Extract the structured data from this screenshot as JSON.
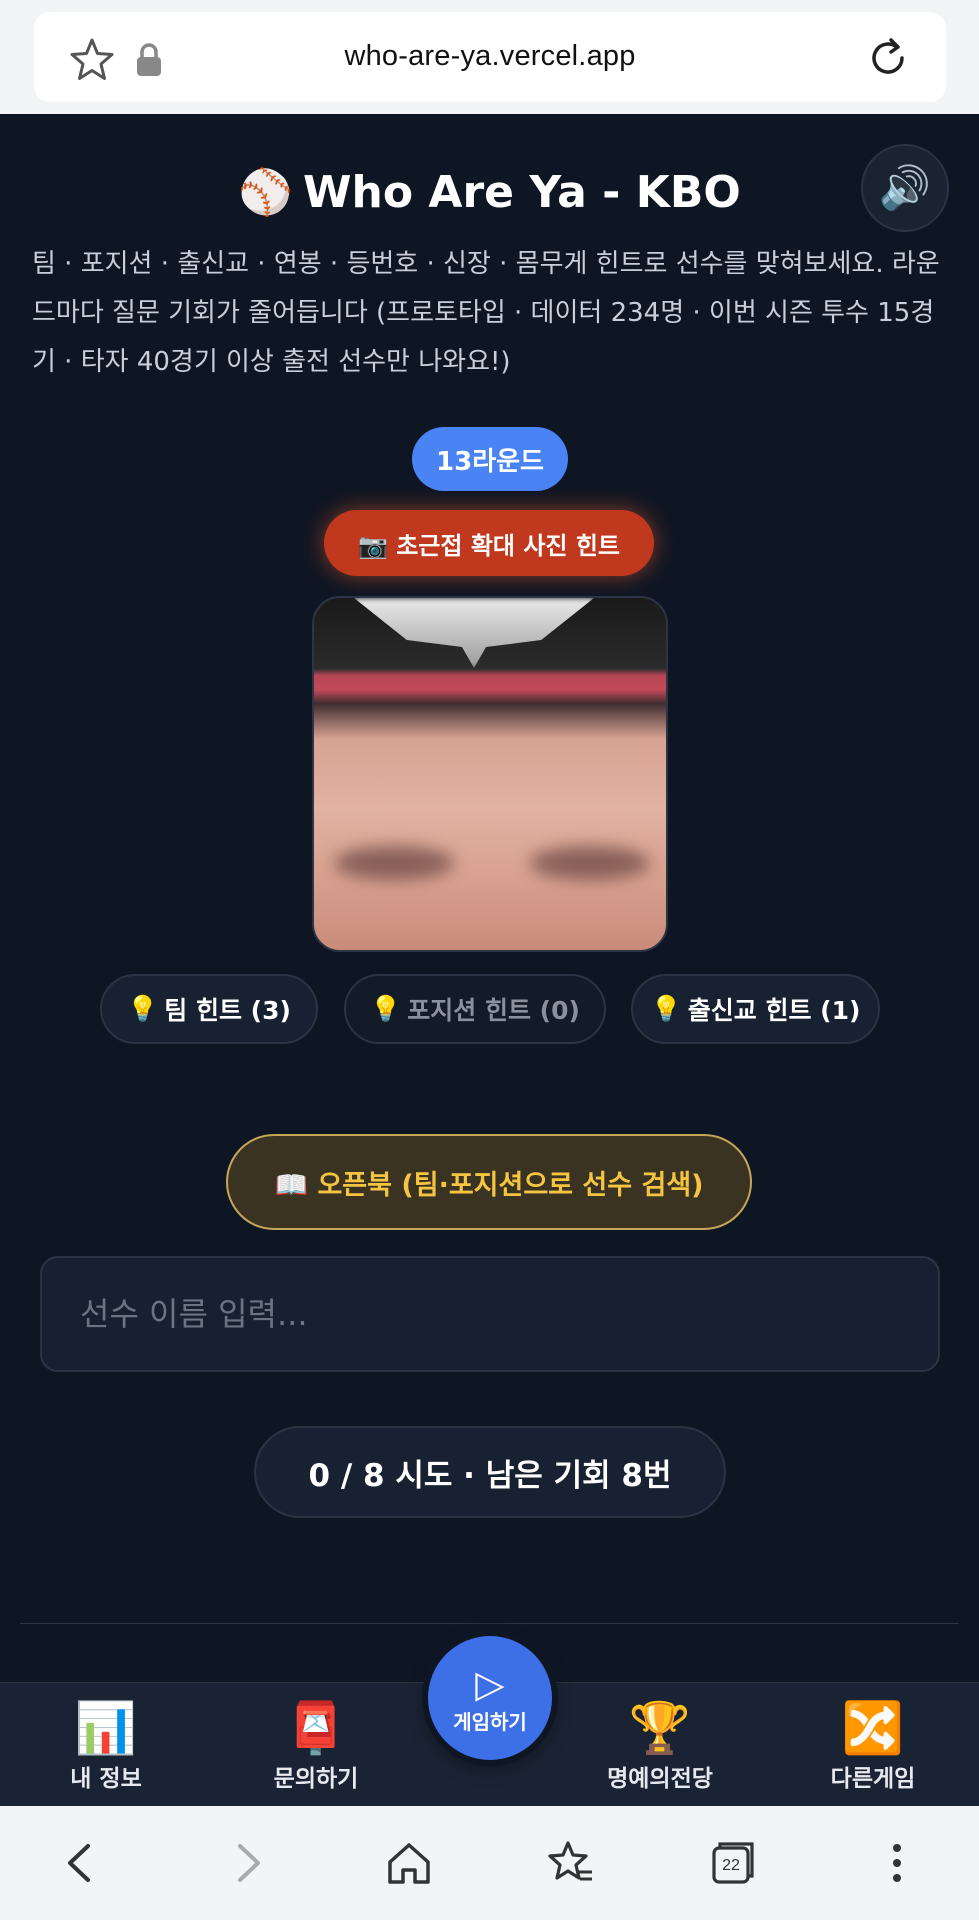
{
  "browser": {
    "url": "who-are-ya.vercel.app",
    "tab_count": "22"
  },
  "app": {
    "title_icon": "⚾",
    "title": "Who Are Ya - KBO",
    "sound_icon": "🔊",
    "subtitle": "팀 · 포지션 · 출신교 · 연봉 · 등번호 · 신장 · 몸무게 힌트로 선수를 맞혀보세요. 라운드마다 질문 기회가 줄어듭니다 (프로토타입 · 데이터 234명 · 이번 시즌 투수 15경기 · 타자 40경기 이상 출전 선수만 나와요!)",
    "round_label": "13라운드",
    "photo_hint_label": "📷 초근접 확대 사진 힌트",
    "hints": [
      {
        "icon": "💡",
        "label": "팀 힌트 (3)",
        "enabled": true
      },
      {
        "icon": "💡",
        "label": "포지션 힌트 (0)",
        "enabled": false
      },
      {
        "icon": "💡",
        "label": "출신교 힌트 (1)",
        "enabled": true
      }
    ],
    "openbook_label": "📖 오픈북 (팀·포지션으로 선수 검색)",
    "search": {
      "placeholder": "선수 이름 입력...",
      "value": ""
    },
    "attempts_text": "0 / 8 시도 · 남은 기회 8번"
  },
  "nav": {
    "items": [
      {
        "icon": "📊",
        "label": "내 정보"
      },
      {
        "icon": "📮",
        "label": "문의하기"
      },
      {
        "icon": "🏆",
        "label": "명예의전당"
      },
      {
        "icon": "🔀",
        "label": "다른게임"
      }
    ],
    "play": {
      "icon": "▷",
      "label": "게임하기"
    }
  },
  "colors": {
    "background": "#0f1623",
    "round_pill": "#4a84f4",
    "photo_hint": "#c0391f",
    "openbook_text": "#f5c542",
    "play_button": "#3d6fe6"
  }
}
